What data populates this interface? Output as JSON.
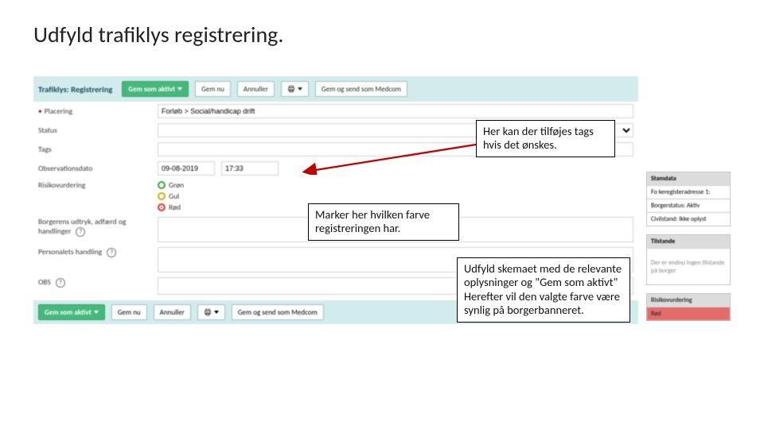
{
  "slide": {
    "title": "Udfyld trafiklys registrering."
  },
  "toolbar": {
    "section_title": "Trafiklys: Registrering",
    "save_active": "Gem som aktivt",
    "save_now": "Gem nu",
    "cancel": "Annuller",
    "save_as_notification": "Gem og send som Medcom"
  },
  "form": {
    "placering_label": "Placering",
    "placering_value": "Forløb > Social/handicap drift",
    "status_label": "Status",
    "tags_label": "Tags",
    "obs_date_label": "Observationsdato",
    "obs_date": "09-08-2019",
    "obs_time": "17:33",
    "risk_label": "Risikovurdering",
    "green": "Grøn",
    "yellow": "Gul",
    "red": "Rød",
    "citizen_expr_label": "Borgerens udtryk, adfærd og handlinger",
    "staff_action_label": "Personalets handling",
    "obs_short_label": "OBS"
  },
  "sidebar": {
    "stamdata_title": "Stamdata",
    "address": "Fo keregisteradresse 1:",
    "citizen_status": "Borgerstatus: Aktiv",
    "civil": "Civilstand: Ikke oplyst",
    "states_title": "Tilstande",
    "states_empty": "Der er endnu ingen tilstande på borger",
    "risk_title": "Risikovurdering",
    "risk_value": "Rød"
  },
  "callouts": {
    "tags": "Her kan der tilføjes tags hvis det ønskes.",
    "marker": "Marker her hvilken farve registreringen har.",
    "schema": "Udfyld skemaet med de relevante oplysninger og \"Gem som aktivt\" Herefter vil den valgte farve være synlig på borgerbanneret."
  }
}
